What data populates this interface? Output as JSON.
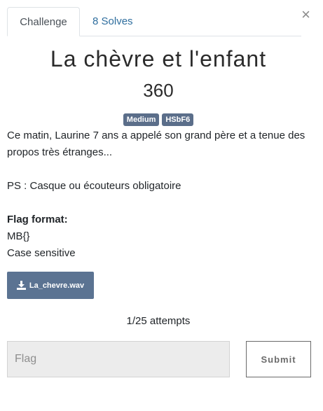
{
  "tabs": {
    "challenge_label": "Challenge",
    "solves_label": "8 Solves"
  },
  "close_symbol": "×",
  "challenge": {
    "name": "La chèvre et l'enfant",
    "value": "360",
    "tags": [
      "Medium",
      "HSbF6"
    ],
    "description": {
      "line1": "Ce matin, Laurine 7 ans a appelé son grand père et a tenue des propos très étranges...",
      "line2": "PS : Casque ou écouteurs obligatoire",
      "flag_format_label": "Flag format:",
      "flag_format_value": "MB{}",
      "case_note": "Case sensitive"
    },
    "file_label": "La_chevre.wav",
    "attempts": "1/25 attempts"
  },
  "form": {
    "flag_placeholder": "Flag",
    "flag_value": "",
    "submit_label": "Submit"
  },
  "icons": {
    "file": "download-icon",
    "close": "close-icon"
  },
  "colors": {
    "tag_bg": "#5b6e8a",
    "file_button_bg": "#5b7392",
    "tab_link": "#2f6e9e"
  }
}
